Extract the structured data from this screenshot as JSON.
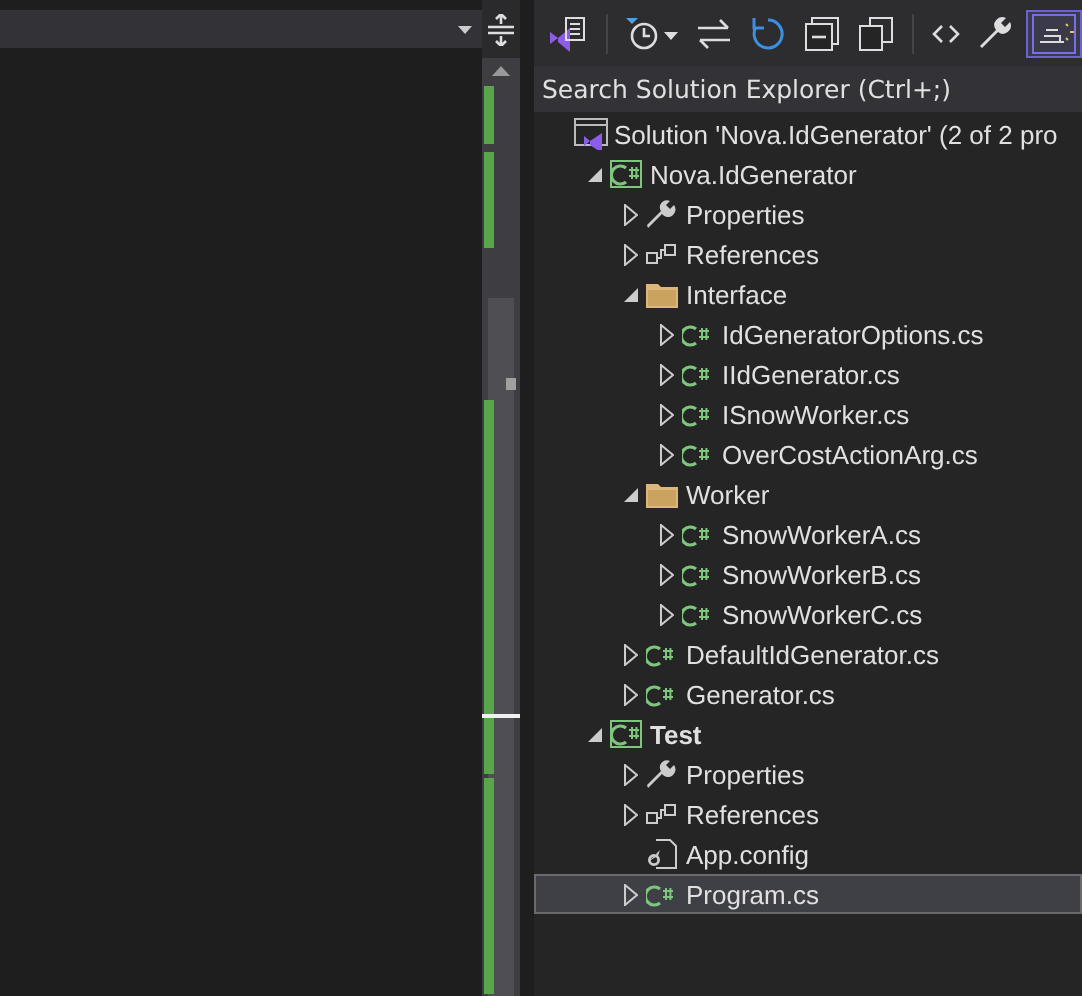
{
  "toolbar": [
    {
      "kind": "solution-switch",
      "selected": false
    },
    {
      "kind": "separator"
    },
    {
      "kind": "history",
      "selected": false
    },
    {
      "kind": "sync",
      "selected": false
    },
    {
      "kind": "refresh",
      "selected": false
    },
    {
      "kind": "collapse",
      "selected": false
    },
    {
      "kind": "copy",
      "selected": false
    },
    {
      "kind": "separator"
    },
    {
      "kind": "code",
      "selected": false
    },
    {
      "kind": "properties",
      "selected": false
    },
    {
      "kind": "preview",
      "selected": true
    }
  ],
  "search": {
    "placeholder": "Search Solution Explorer (Ctrl+;)"
  },
  "tree": [
    {
      "label": "Solution 'Nova.IdGenerator' (2 of 2 pro",
      "kind": "solution",
      "selected": false,
      "children": [
        {
          "label": "Nova.IdGenerator",
          "kind": "project",
          "startup": false,
          "expanded": true,
          "selected": false,
          "children": [
            {
              "label": "Properties",
              "kind": "properties",
              "expanded": false,
              "selected": false
            },
            {
              "label": "References",
              "kind": "references",
              "expanded": false,
              "selected": false
            },
            {
              "label": "Interface",
              "kind": "folder",
              "expanded": true,
              "selected": false,
              "children": [
                {
                  "label": "IdGeneratorOptions.cs",
                  "kind": "cs",
                  "expanded": false,
                  "selected": false
                },
                {
                  "label": "IIdGenerator.cs",
                  "kind": "cs",
                  "expanded": false,
                  "selected": false
                },
                {
                  "label": "ISnowWorker.cs",
                  "kind": "cs",
                  "expanded": false,
                  "selected": false
                },
                {
                  "label": "OverCostActionArg.cs",
                  "kind": "cs",
                  "expanded": false,
                  "selected": false
                }
              ]
            },
            {
              "label": "Worker",
              "kind": "folder",
              "expanded": true,
              "selected": false,
              "children": [
                {
                  "label": "SnowWorkerA.cs",
                  "kind": "cs",
                  "expanded": false,
                  "selected": false
                },
                {
                  "label": "SnowWorkerB.cs",
                  "kind": "cs",
                  "expanded": false,
                  "selected": false
                },
                {
                  "label": "SnowWorkerC.cs",
                  "kind": "cs",
                  "expanded": false,
                  "selected": false
                }
              ]
            },
            {
              "label": "DefaultIdGenerator.cs",
              "kind": "cs",
              "expanded": false,
              "selected": false
            },
            {
              "label": "Generator.cs",
              "kind": "cs",
              "expanded": false,
              "selected": false
            }
          ]
        },
        {
          "label": "Test",
          "kind": "project",
          "startup": true,
          "expanded": true,
          "selected": false,
          "children": [
            {
              "label": "Properties",
              "kind": "properties",
              "expanded": false,
              "selected": false
            },
            {
              "label": "References",
              "kind": "references",
              "expanded": false,
              "selected": false
            },
            {
              "label": "App.config",
              "kind": "config",
              "selected": false
            },
            {
              "label": "Program.cs",
              "kind": "cs",
              "expanded": false,
              "selected": true
            }
          ]
        }
      ]
    }
  ]
}
